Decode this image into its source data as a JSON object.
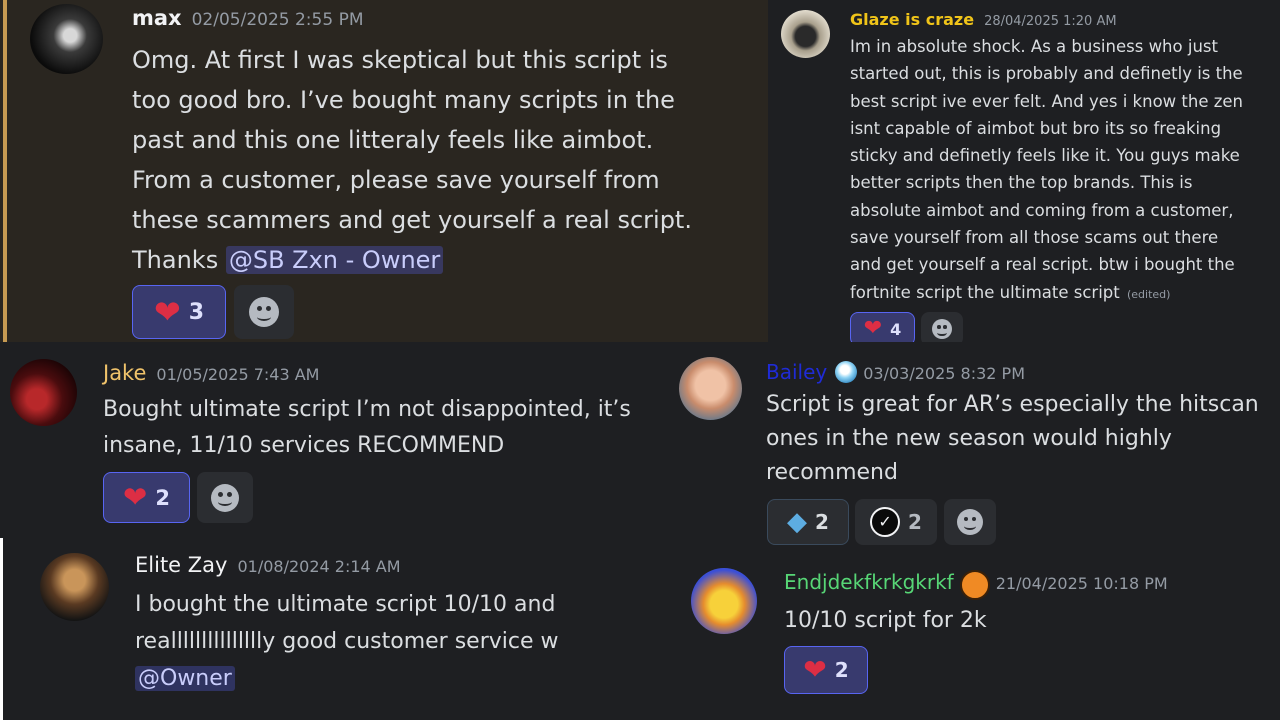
{
  "messages": {
    "max": {
      "username": "max",
      "timestamp": "02/05/2025 2:55 PM",
      "lines": [
        "Omg. At first I was skeptical but this script is",
        "too good bro. I’ve bought many scripts in the",
        "past and this one litteraly feels like aimbot.",
        "From a customer, please save yourself from",
        "these scammers and get yourself a real script."
      ],
      "last_prefix": "Thanks ",
      "mention": "@SB Zxn - Owner",
      "reaction": {
        "emoji": "heart",
        "count": "3"
      }
    },
    "glaze": {
      "username": "Glaze is craze",
      "timestamp": "28/04/2025 1:20 AM",
      "lines": [
        "Im in absolute shock. As a business who just",
        "started out, this is probably and definetly is the",
        "best script ive ever felt. And yes i know the zen",
        "isnt capable of aimbot but bro its so freaking",
        "sticky and definetly feels like it. You guys make",
        "better scripts then the top brands. This is",
        "absolute aimbot and coming from a customer,",
        "save yourself from all those scams out there",
        "and get yourself a real script. btw i bought the"
      ],
      "last_line": "fortnite script the ultimate script",
      "edited": "(edited)",
      "reaction": {
        "emoji": "heart",
        "count": "4"
      }
    },
    "jake": {
      "username": "Jake",
      "timestamp": "01/05/2025 7:43 AM",
      "lines": [
        "Bought ultimate script I’m not disappointed, it’s",
        "insane, 11/10 services RECOMMEND"
      ],
      "reaction": {
        "emoji": "heart",
        "count": "2"
      }
    },
    "bailey": {
      "username": "Bailey",
      "timestamp": "03/03/2025 8:32 PM",
      "badge": "droplet-badge-icon",
      "lines": [
        "Script is great for AR’s especially the hitscan",
        "ones in the new season would highly",
        "recommend"
      ],
      "reactions": [
        {
          "emoji": "diamond",
          "count": "2"
        },
        {
          "emoji": "verified-check",
          "count": "2"
        }
      ]
    },
    "elite": {
      "username": "Elite Zay",
      "timestamp": "01/08/2024 2:14 AM",
      "lines": [
        "I bought the ultimate script 10/10 and",
        "reallllllllllllllly good customer service w"
      ],
      "mention": "@Owner"
    },
    "endj": {
      "username": "Endjdekfkrkgkrkf",
      "badge": "🏀",
      "timestamp": "21/04/2025 10:18 PM",
      "lines": [
        "10/10 script for 2k"
      ],
      "reaction": {
        "emoji": "heart",
        "count": "2"
      }
    }
  },
  "colors": {
    "discord_bg": "#1e1f22",
    "max_panel_bg": "#2a2620",
    "max_accent_bar": "#c69a52",
    "glaze_name": "#f0c419",
    "jake_name": "#f0c36b",
    "bailey_name": "#1f2bd6",
    "endj_name": "#57d676",
    "white_name": "#f2f3f5",
    "heart": "#dd2e44",
    "diamond": "#5dade2"
  }
}
